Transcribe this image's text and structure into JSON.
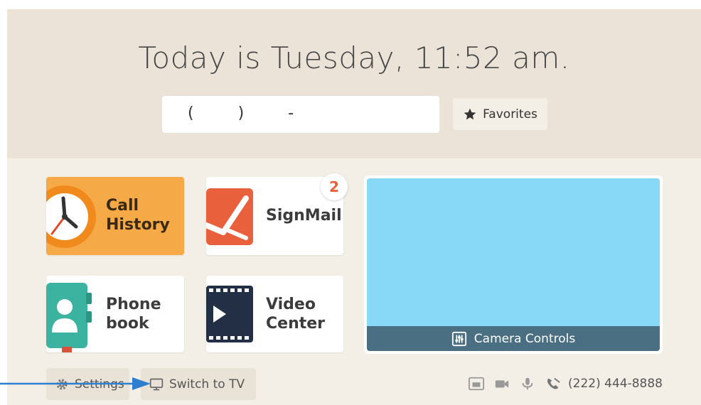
{
  "header": {
    "title": "Today is Tuesday, 11:52 am.",
    "dial_mask": "(  )  -",
    "favorites_label": "Favorites"
  },
  "tiles": {
    "call_history": {
      "label_line1": "Call",
      "label_line2": "History"
    },
    "signmail": {
      "label": "SignMail",
      "badge": "2"
    },
    "phonebook": {
      "label_line1": "Phone",
      "label_line2": "book"
    },
    "video_center": {
      "label_line1": "Video",
      "label_line2": "Center"
    }
  },
  "preview": {
    "camera_controls_label": "Camera Controls"
  },
  "footer": {
    "settings_label": "Settings",
    "switch_tv_label": "Switch to TV",
    "phone_number": "(222) 444-8888",
    "status_icons": [
      "network-icon",
      "camera-icon",
      "microphone-icon",
      "phone-muted-icon"
    ]
  },
  "colors": {
    "accent_orange": "#f6a947",
    "signmail_red": "#e8603c",
    "phonebook_teal": "#3bb3a0",
    "preview_blue": "#88d8f8",
    "camera_bar": "#4b6f82",
    "annotation_arrow": "#2f7fd0"
  }
}
